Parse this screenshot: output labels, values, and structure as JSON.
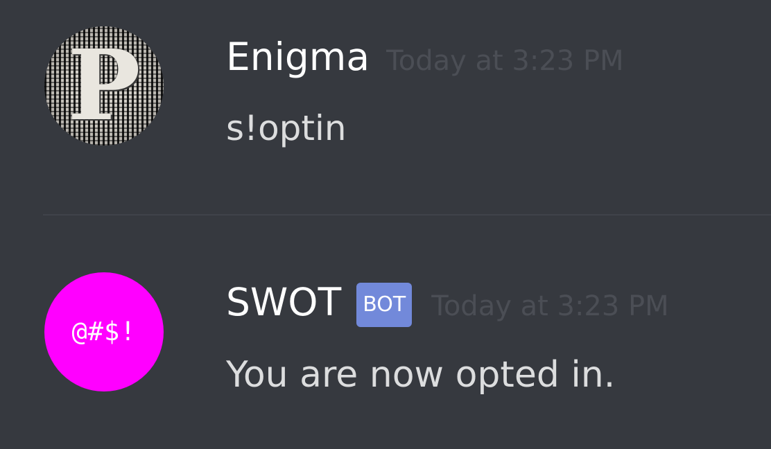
{
  "messages": [
    {
      "username": "Enigma",
      "timestamp": "Today at 3:23 PM",
      "content": "s!optin",
      "avatar": {
        "icon": "user-avatar-icon",
        "letter": "P"
      }
    },
    {
      "username": "SWOT",
      "badge": "BOT",
      "timestamp": "Today at 3:23 PM",
      "content": "You are now opted in.",
      "avatar": {
        "icon": "bot-avatar-icon",
        "text": "@#$!",
        "color": "#ff00ff"
      }
    }
  ],
  "colors": {
    "background": "#36393f",
    "username": "#ffffff",
    "timestamp": "#4b4e55",
    "message_text": "#dcddde",
    "bot_badge": "#7289da",
    "divider": "#40434a"
  }
}
